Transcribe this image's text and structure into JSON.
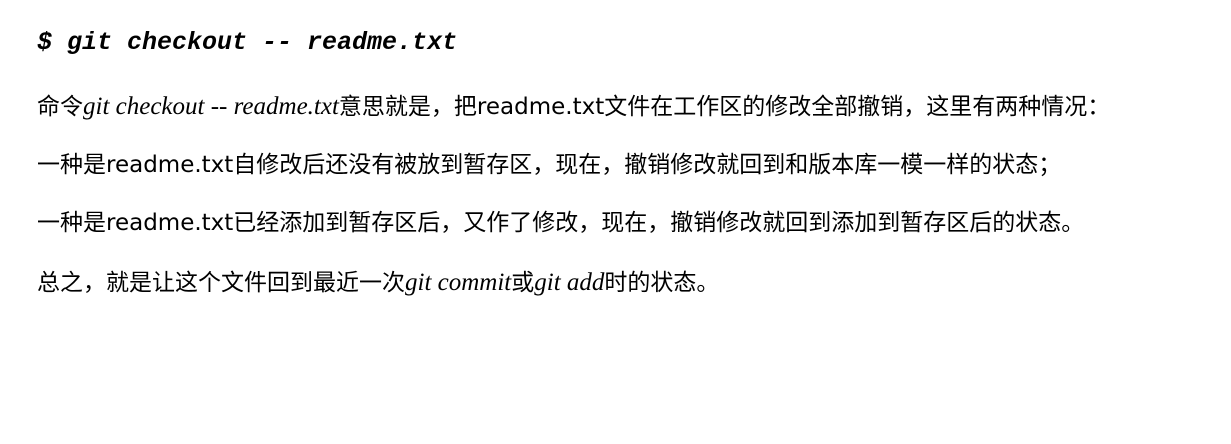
{
  "command": "$ git checkout -- readme.txt",
  "p1": {
    "a": "命令",
    "b": "git checkout -- readme.txt",
    "c": "意思就是，把readme.txt文件在工作区的修改全部撤销，这里有两种情况："
  },
  "p2": "一种是readme.txt自修改后还没有被放到暂存区，现在，撤销修改就回到和版本库一模一样的状态；",
  "p3": "一种是readme.txt已经添加到暂存区后，又作了修改，现在，撤销修改就回到添加到暂存区后的状态。",
  "p4": {
    "a": "总之，就是让这个文件回到最近一次",
    "b": "git commit",
    "c": "或",
    "d": "git add",
    "e": "时的状态。"
  }
}
